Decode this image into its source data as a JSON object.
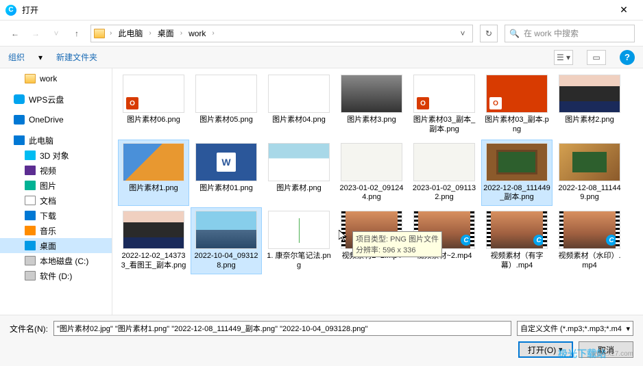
{
  "titlebar": {
    "title": "打开"
  },
  "nav": {
    "path_segments": [
      "此电脑",
      "桌面",
      "work"
    ],
    "search_placeholder": "在 work 中搜索"
  },
  "toolbar": {
    "organize": "组织",
    "new_folder": "新建文件夹"
  },
  "sidebar": {
    "items": [
      {
        "label": "work",
        "icon": "folder",
        "indent": 1
      },
      {
        "label": "WPS云盘",
        "icon": "cloud",
        "indent": 0
      },
      {
        "label": "OneDrive",
        "icon": "cloud2",
        "indent": 0
      },
      {
        "label": "此电脑",
        "icon": "pc",
        "indent": 0
      },
      {
        "label": "3D 对象",
        "icon": "obj3d",
        "indent": 1
      },
      {
        "label": "视频",
        "icon": "video",
        "indent": 1
      },
      {
        "label": "图片",
        "icon": "pic",
        "indent": 1
      },
      {
        "label": "文档",
        "icon": "doc",
        "indent": 1
      },
      {
        "label": "下载",
        "icon": "dl",
        "indent": 1
      },
      {
        "label": "音乐",
        "icon": "music",
        "indent": 1
      },
      {
        "label": "桌面",
        "icon": "desktop",
        "indent": 1,
        "selected": true
      },
      {
        "label": "本地磁盘 (C:)",
        "icon": "drive",
        "indent": 1
      },
      {
        "label": "软件 (D:)",
        "icon": "drive",
        "indent": 1
      }
    ]
  },
  "files": [
    {
      "label": "图片素材06.png",
      "thumb": "office"
    },
    {
      "label": "图片素材05.png",
      "thumb": "textdoc"
    },
    {
      "label": "图片素材04.png",
      "thumb": "textdoc"
    },
    {
      "label": "图片素材3.png",
      "thumb": "man"
    },
    {
      "label": "图片素材03_副本_副本.png",
      "thumb": "office"
    },
    {
      "label": "图片素材03_副本.png",
      "thumb": "office-orange"
    },
    {
      "label": "图片素材2.png",
      "thumb": "woman"
    },
    {
      "label": "图片素材1.png",
      "thumb": "leaf",
      "selected": true
    },
    {
      "label": "图片素材01.png",
      "thumb": "word"
    },
    {
      "label": "图片素材.png",
      "thumb": "doctor"
    },
    {
      "label": "2023-01-02_091244.png",
      "thumb": "sign"
    },
    {
      "label": "2023-01-02_091132.png",
      "thumb": "sign"
    },
    {
      "label": "2022-12-08_111449_副本.png",
      "thumb": "board",
      "selected": true
    },
    {
      "label": "2022-12-08_111449.png",
      "thumb": "board2"
    },
    {
      "label": "2022-12-02_143733_看图王_副本.png",
      "thumb": "woman"
    },
    {
      "label": "2022-10-04_093128.png",
      "thumb": "mountain",
      "selected": true,
      "hover": true
    },
    {
      "label": "1. 康奈尔笔记法.png",
      "thumb": "diagram"
    },
    {
      "label": "视频素材2~2.mp4",
      "thumb": "city",
      "video": true
    },
    {
      "label": "视频素材~2.mp4",
      "thumb": "city",
      "video": true
    },
    {
      "label": "视频素材（有字幕）.mp4",
      "thumb": "city",
      "video": true
    },
    {
      "label": "视频素材（水印）.mp4",
      "thumb": "city",
      "video": true
    }
  ],
  "tooltip": {
    "line1": "项目类型: PNG 图片文件",
    "line2": "分辨率: 596 x 336"
  },
  "bottom": {
    "filename_label": "文件名(N):",
    "filename_value": "\"图片素材02.jpg\" \"图片素材1.png\" \"2022-12-08_111449_副本.png\" \"2022-10-04_093128.png\"",
    "filter_value": "自定义文件 (*.mp3;*.mp3;*.m4",
    "open_label": "打开(O)",
    "cancel_label": "取消"
  },
  "watermark": {
    "text": "极光下载站",
    "url": "www.xz7.com"
  }
}
